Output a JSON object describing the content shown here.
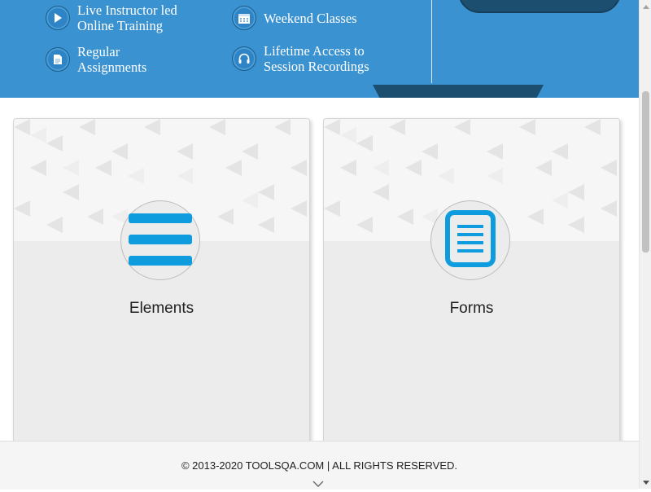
{
  "banner": {
    "features": [
      {
        "line1": "Live Instructor led",
        "line2": "Online Training",
        "icon": "play-icon"
      },
      {
        "line1": "Weekend Classes",
        "line2": "",
        "icon": "calendar-icon"
      },
      {
        "line1": "Regular",
        "line2": "Assignments",
        "icon": "document-icon"
      },
      {
        "line1": "Lifetime Access to",
        "line2": "Session Recordings",
        "icon": "headphones-icon"
      }
    ],
    "colors": {
      "background": "#3a92d0",
      "button": "#1c4e70"
    }
  },
  "cards": [
    {
      "title": "Elements",
      "icon": "hamburger-menu-icon"
    },
    {
      "title": "Forms",
      "icon": "form-document-icon"
    }
  ],
  "footer": {
    "copyright": "© 2013-2020 TOOLSQA.COM | ALL RIGHTS RESERVED.",
    "icon": "chevron-down-icon"
  },
  "colors": {
    "accent": "#0f9cde"
  }
}
